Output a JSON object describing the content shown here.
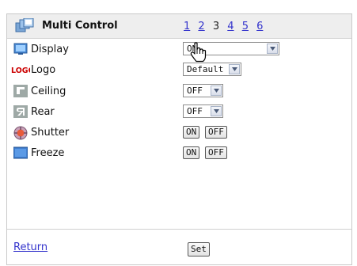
{
  "header": {
    "title": "Multi Control",
    "title_icon": "multi-control-icon",
    "pages": [
      {
        "label": "1",
        "current": false
      },
      {
        "label": "2",
        "current": false
      },
      {
        "label": "3",
        "current": true
      },
      {
        "label": "4",
        "current": false
      },
      {
        "label": "5",
        "current": false
      },
      {
        "label": "6",
        "current": false
      }
    ]
  },
  "rows": {
    "display": {
      "label": "Display",
      "icon": "display-icon",
      "value": "ON"
    },
    "logo": {
      "label": "Logo",
      "icon": "logo-icon",
      "icon_text": "LOGO",
      "value": "Default"
    },
    "ceiling": {
      "label": "Ceiling",
      "icon": "ceiling-icon",
      "value": "OFF"
    },
    "rear": {
      "label": "Rear",
      "icon": "rear-icon",
      "value": "OFF"
    },
    "shutter": {
      "label": "Shutter",
      "icon": "shutter-icon",
      "on_label": "ON",
      "off_label": "OFF"
    },
    "freeze": {
      "label": "Freeze",
      "icon": "freeze-icon",
      "on_label": "ON",
      "off_label": "OFF"
    }
  },
  "footer": {
    "return_label": "Return",
    "set_label": "Set"
  },
  "colors": {
    "link": "#3333cc",
    "logo_red": "#cc0000",
    "title_bar": "#eeeeee"
  }
}
